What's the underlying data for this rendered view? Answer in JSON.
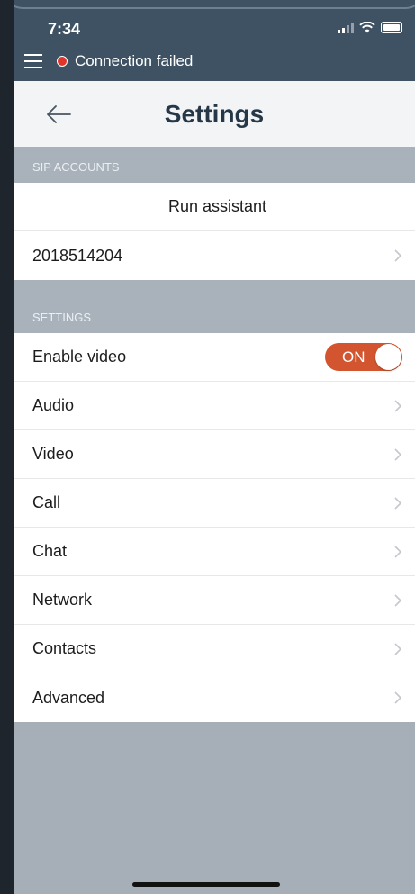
{
  "status_bar": {
    "time": "7:34"
  },
  "connection": {
    "status_text": "Connection failed",
    "status_color": "#e0352b"
  },
  "header": {
    "title": "Settings"
  },
  "sip_accounts": {
    "section_label": "SIP ACCOUNTS",
    "run_assistant_label": "Run assistant",
    "account_number": "2018514204"
  },
  "settings": {
    "section_label": "SETTINGS",
    "enable_video": {
      "label": "Enable video",
      "toggle_text": "ON",
      "enabled": true
    },
    "items": [
      {
        "label": "Audio"
      },
      {
        "label": "Video"
      },
      {
        "label": "Call"
      },
      {
        "label": "Chat"
      },
      {
        "label": "Network"
      },
      {
        "label": "Contacts"
      },
      {
        "label": "Advanced"
      }
    ]
  },
  "colors": {
    "top_bar": "#3e5264",
    "toggle_on": "#d2552f",
    "section_bg": "#a9b2bb",
    "title": "#263847"
  },
  "icons": [
    "menu-icon",
    "back-arrow-icon",
    "chevron-right-icon",
    "signal-icon",
    "wifi-icon",
    "battery-icon"
  ]
}
